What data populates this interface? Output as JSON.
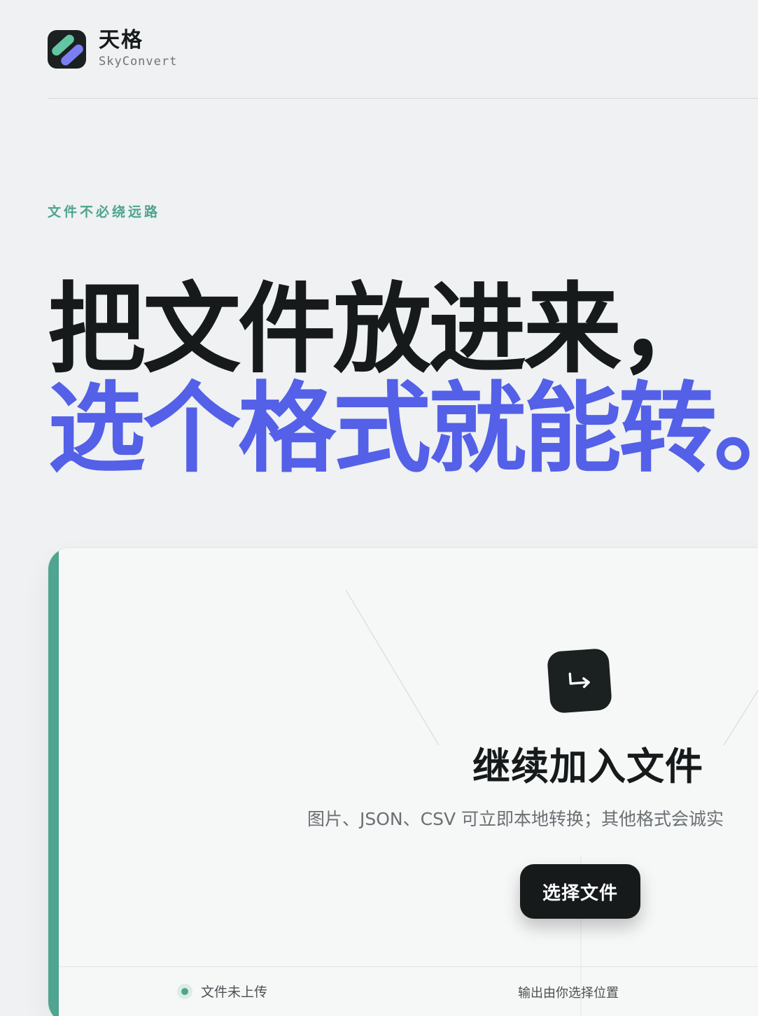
{
  "brand": {
    "name": "天格",
    "subtitle": "SkyConvert",
    "colors": {
      "logo_bg": "#1b2020",
      "logo_bar_green": "#63c6a3",
      "logo_bar_blue": "#7b7ff2"
    }
  },
  "hero": {
    "eyebrow": "文件不必绕远路",
    "headline_line1": "把文件放进来，",
    "headline_line2": "选个格式就能转。",
    "colors": {
      "line1": "#161a1a",
      "line2": "#5360e7",
      "eyebrow": "#4ea48e"
    }
  },
  "dropzone": {
    "icon": "arrow-return-icon",
    "title": "继续加入文件",
    "description": "图片、JSON、CSV 可立即本地转换；其他格式会诚实",
    "select_button": "选择文件",
    "status_text": "文件未上传",
    "output_text": "输出由你选择位置",
    "accent_color": "#4fa58f"
  }
}
